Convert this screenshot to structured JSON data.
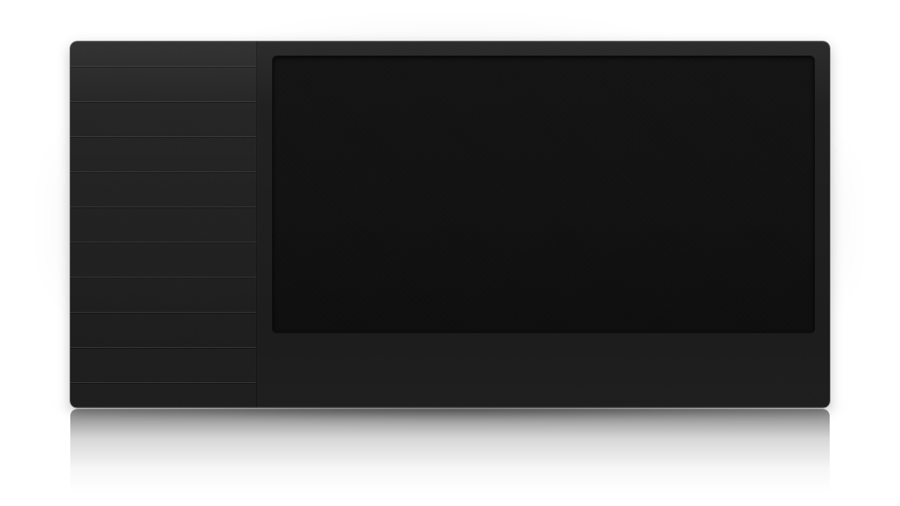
{
  "window": {
    "title": ""
  },
  "sidebar": {
    "items": [
      {
        "label": ""
      },
      {
        "label": ""
      },
      {
        "label": ""
      },
      {
        "label": ""
      },
      {
        "label": ""
      },
      {
        "label": ""
      },
      {
        "label": ""
      },
      {
        "label": ""
      },
      {
        "label": ""
      },
      {
        "label": ""
      }
    ]
  },
  "main": {
    "screen_content": ""
  },
  "colors": {
    "device_body": "#1e1e1e",
    "screen": "#121212",
    "divider_highlight": "#3a3a3a",
    "background": "#ffffff"
  }
}
